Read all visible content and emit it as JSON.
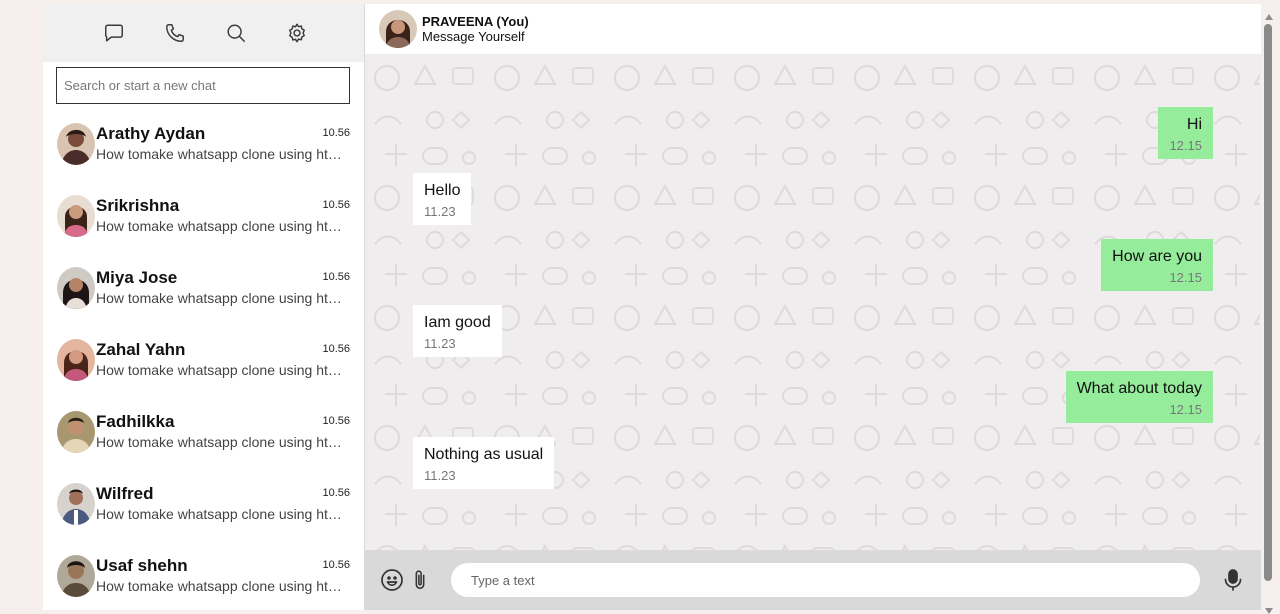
{
  "sidebar": {
    "search_placeholder": "Search or start a new chat",
    "chats": [
      {
        "name": "Arathy Aydan",
        "message": "How tomake whatsapp clone using html css",
        "time": "10.56",
        "avatar_color": "#7a4b3a"
      },
      {
        "name": "Srikrishna",
        "message": "How tomake whatsapp clone using html css",
        "time": "10.56",
        "avatar_color": "#b98a6d"
      },
      {
        "name": "Miya Jose",
        "message": "How tomake whatsapp clone using html css",
        "time": "10.56",
        "avatar_color": "#3a3030"
      },
      {
        "name": "Zahal Yahn",
        "message": "How tomake whatsapp clone using html css",
        "time": "10.56",
        "avatar_color": "#c4587a"
      },
      {
        "name": "Fadhilkka",
        "message": "How tomake whatsapp clone using html css",
        "time": "10.56",
        "avatar_color": "#9c8a5a"
      },
      {
        "name": "Wilfred",
        "message": "How tomake whatsapp clone using html css",
        "time": "10.56",
        "avatar_color": "#4a5a80"
      },
      {
        "name": "Usaf shehn",
        "message": "How tomake whatsapp clone using html css",
        "time": "10.56",
        "avatar_color": "#6b5a42"
      }
    ]
  },
  "header": {
    "name": "PRAVEENA (You)",
    "subtitle": "Message Yourself"
  },
  "messages": [
    {
      "text": "Hi",
      "time": "12.15",
      "direction": "out"
    },
    {
      "text": "Hello",
      "time": "11.23",
      "direction": "in"
    },
    {
      "text": "How are you",
      "time": "12.15",
      "direction": "out"
    },
    {
      "text": "Iam good",
      "time": "11.23",
      "direction": "in"
    },
    {
      "text": "What about today",
      "time": "12.15",
      "direction": "out"
    },
    {
      "text": "Nothing as usual",
      "time": "11.23",
      "direction": "in"
    }
  ],
  "composer": {
    "placeholder": "Type a text"
  },
  "colors": {
    "outgoing_bubble": "#95ec9b",
    "incoming_bubble": "#ffffff",
    "chat_background": "#efeded"
  }
}
